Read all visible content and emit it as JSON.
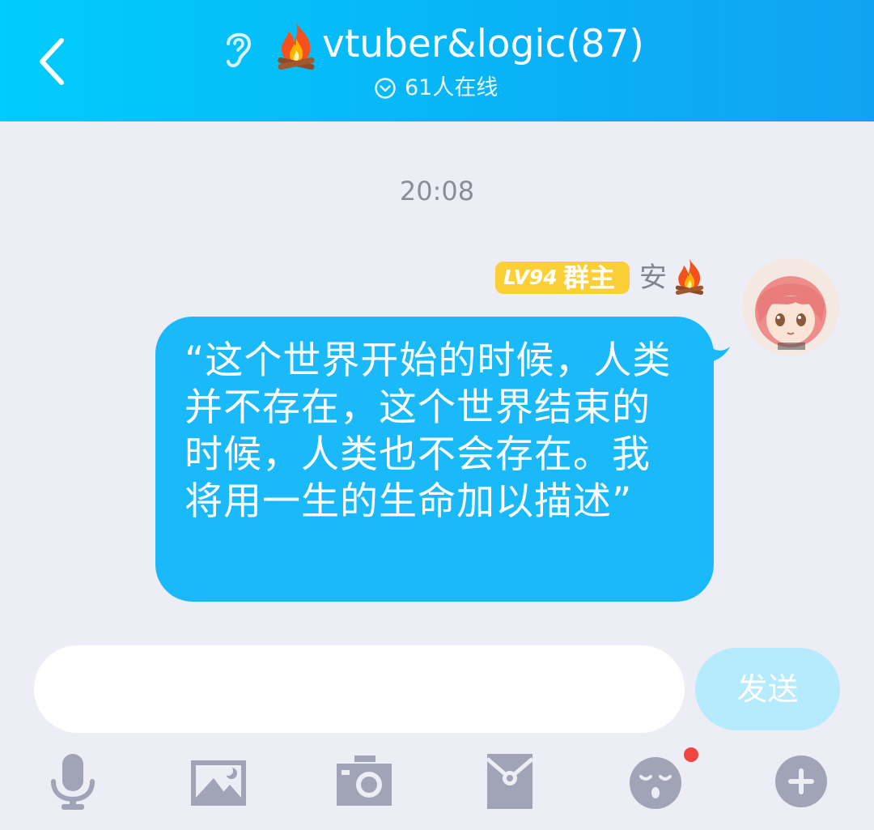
{
  "header": {
    "title": "vtuber&logic(87)",
    "online_count": "61人在线"
  },
  "chat": {
    "timestamp": "20:08",
    "message": {
      "sender": {
        "level": "LV94",
        "role": "群主",
        "name": "安"
      },
      "text": "“这个世界开始的时候，人类并不存在，这个世界结束的时候，人类也不会存在。我将用一生的生命加以描述”"
    }
  },
  "composer": {
    "input_value": "",
    "send_label": "发送"
  },
  "toolbar": {
    "icons": [
      "microphone-icon",
      "image-icon",
      "camera-icon",
      "red-packet-icon",
      "emoji-icon",
      "plus-icon"
    ],
    "notification_color": "#f2453d"
  },
  "colors": {
    "header_gradient_start": "#00cdfb",
    "header_gradient_end": "#11a3f3",
    "bubble": "#19b9fa",
    "badge": "#fbcf36",
    "send_button": "#b5ebfd",
    "background": "#ededf5",
    "toolbar_icon": "#a1a3b6"
  }
}
